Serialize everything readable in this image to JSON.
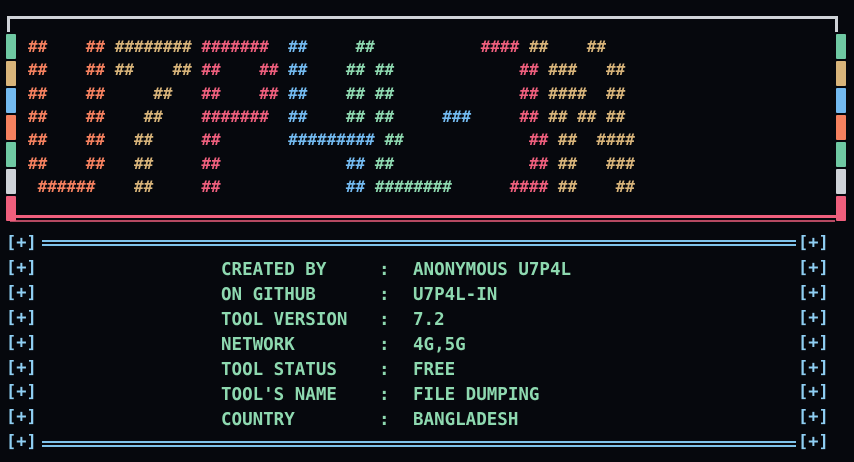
{
  "banner": {
    "rows": [
      [
        {
          "t": "##    ## ",
          "c": "#f5815f"
        },
        {
          "t": "######## ",
          "c": "#d8b47a"
        },
        {
          "t": "#######  ",
          "c": "#ef5f7d"
        },
        {
          "t": "##     ",
          "c": "#73baf0"
        },
        {
          "t": "##      ",
          "c": "#8ed9b0"
        },
        {
          "t": "     ",
          "c": "#73baf0"
        },
        {
          "t": "#### ",
          "c": "#ef5f7d"
        },
        {
          "t": "##    ##",
          "c": "#d8b47a"
        }
      ],
      [
        {
          "t": "##    ## ",
          "c": "#f5815f"
        },
        {
          "t": "##    ## ",
          "c": "#d8b47a"
        },
        {
          "t": "##    ## ",
          "c": "#ef5f7d"
        },
        {
          "t": "##    ",
          "c": "#73baf0"
        },
        {
          "t": "## ",
          "c": "#8ed9b0"
        },
        {
          "t": "##      ",
          "c": "#8ed9b0"
        },
        {
          "t": "     ",
          "c": "#73baf0"
        },
        {
          "t": "  ## ",
          "c": "#ef5f7d"
        },
        {
          "t": "###   ##",
          "c": "#d8b47a"
        }
      ],
      [
        {
          "t": "##    ## ",
          "c": "#f5815f"
        },
        {
          "t": "    ##   ",
          "c": "#d8b47a"
        },
        {
          "t": "##    ## ",
          "c": "#ef5f7d"
        },
        {
          "t": "##    ",
          "c": "#73baf0"
        },
        {
          "t": "## ",
          "c": "#8ed9b0"
        },
        {
          "t": "##      ",
          "c": "#8ed9b0"
        },
        {
          "t": "     ",
          "c": "#73baf0"
        },
        {
          "t": "  ## ",
          "c": "#ef5f7d"
        },
        {
          "t": "####  ##",
          "c": "#d8b47a"
        }
      ],
      [
        {
          "t": "##    ## ",
          "c": "#f5815f"
        },
        {
          "t": "   ##    ",
          "c": "#d8b47a"
        },
        {
          "t": "#######  ",
          "c": "#ef5f7d"
        },
        {
          "t": "##    ",
          "c": "#73baf0"
        },
        {
          "t": "## ",
          "c": "#8ed9b0"
        },
        {
          "t": "##     ",
          "c": "#8ed9b0"
        },
        {
          "t": "###   ",
          "c": "#73baf0"
        },
        {
          "t": "  ## ",
          "c": "#ef5f7d"
        },
        {
          "t": "## ## ##",
          "c": "#d8b47a"
        }
      ],
      [
        {
          "t": "##    ## ",
          "c": "#f5815f"
        },
        {
          "t": "  ##     ",
          "c": "#d8b47a"
        },
        {
          "t": "##       ",
          "c": "#ef5f7d"
        },
        {
          "t": "######### ",
          "c": "#73baf0"
        },
        {
          "t": "##      ",
          "c": "#8ed9b0"
        },
        {
          "t": "     ",
          "c": "#73baf0"
        },
        {
          "t": "  ## ",
          "c": "#ef5f7d"
        },
        {
          "t": "##  ####",
          "c": "#d8b47a"
        }
      ],
      [
        {
          "t": "##    ## ",
          "c": "#f5815f"
        },
        {
          "t": "  ##     ",
          "c": "#d8b47a"
        },
        {
          "t": "##       ",
          "c": "#ef5f7d"
        },
        {
          "t": "      ## ",
          "c": "#73baf0"
        },
        {
          "t": "##      ",
          "c": "#8ed9b0"
        },
        {
          "t": "      ",
          "c": "#73baf0"
        },
        {
          "t": "  ## ",
          "c": "#ef5f7d"
        },
        {
          "t": "##   ###",
          "c": "#d8b47a"
        }
      ],
      [
        {
          "t": " ######  ",
          "c": "#f5815f"
        },
        {
          "t": "  ##     ",
          "c": "#d8b47a"
        },
        {
          "t": "##       ",
          "c": "#ef5f7d"
        },
        {
          "t": "      ## ",
          "c": "#73baf0"
        },
        {
          "t": "########",
          "c": "#8ed9b0"
        },
        {
          "t": "      ",
          "c": "#73baf0"
        },
        {
          "t": "#### ",
          "c": "#ef5f7d"
        },
        {
          "t": "##    ##",
          "c": "#d8b47a"
        }
      ]
    ],
    "strip_colors": [
      "#6fc9a3",
      "#d8b47a",
      "#73baf0",
      "#f5815f",
      "#6fc9a3",
      "#cfd3d8",
      "#ef5f7d"
    ]
  },
  "panel": {
    "bracket": "[+]",
    "rows": [
      {
        "key": "CREATED BY",
        "sep": ":",
        "value": "ANONYMOUS U7P4L"
      },
      {
        "key": "ON GITHUB",
        "sep": ":",
        "value": "U7P4L-IN"
      },
      {
        "key": "TOOL VERSION",
        "sep": ":",
        "value": "7.2"
      },
      {
        "key": "NETWORK",
        "sep": ":",
        "value": "4G,5G"
      },
      {
        "key": "TOOL STATUS",
        "sep": ":",
        "value": "FREE"
      },
      {
        "key": "TOOL'S NAME",
        "sep": ":",
        "value": "FILE DUMPING"
      },
      {
        "key": "COUNTRY",
        "sep": ":",
        "value": "BANGLADESH"
      }
    ]
  }
}
